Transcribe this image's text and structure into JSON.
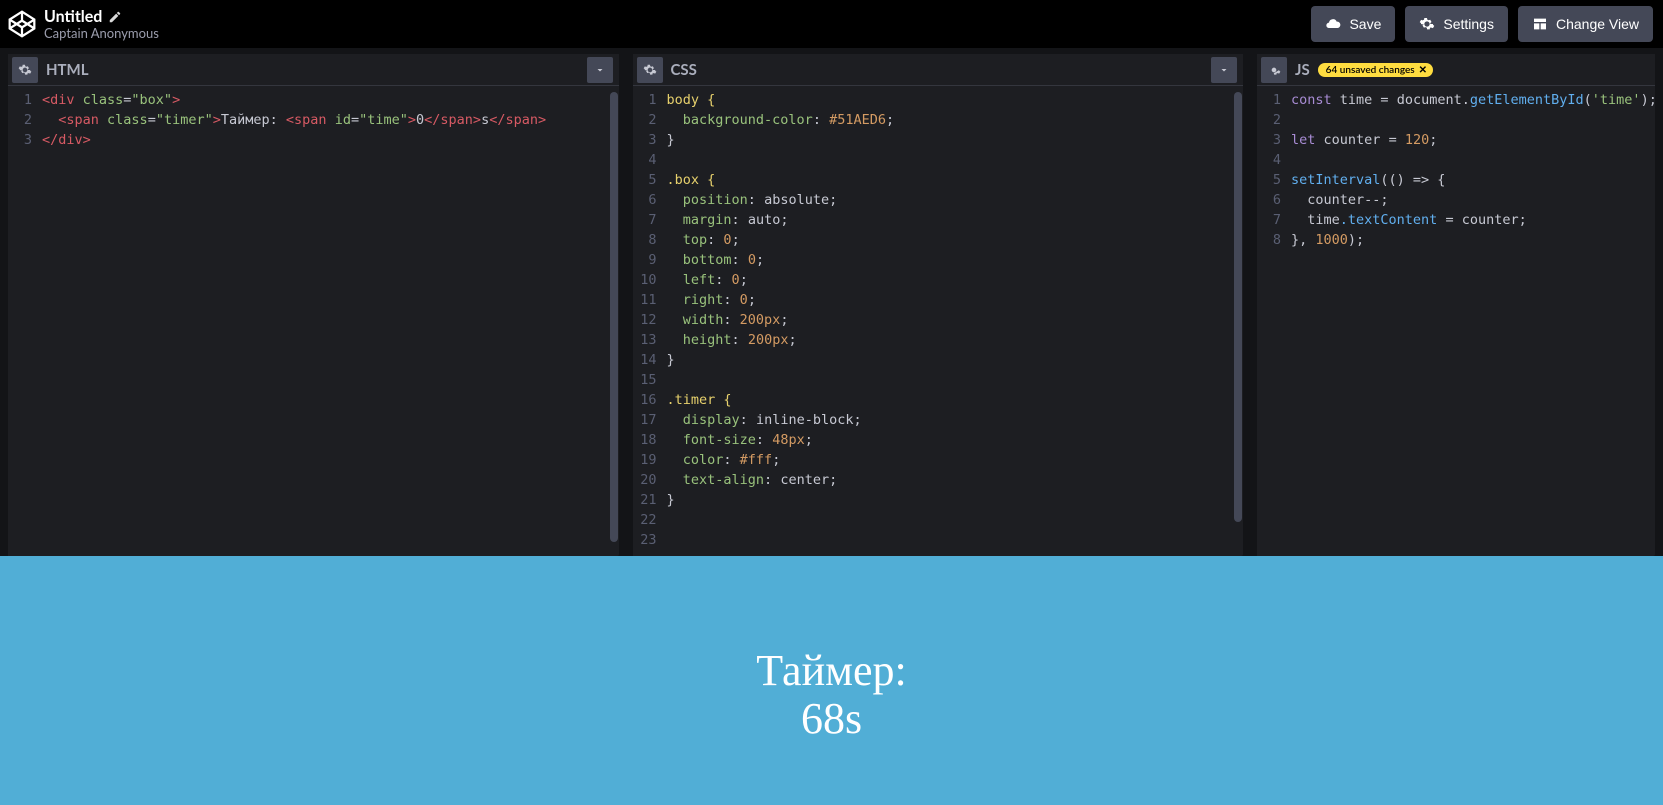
{
  "header": {
    "title": "Untitled",
    "author": "Captain Anonymous",
    "buttons": {
      "save": "Save",
      "settings": "Settings",
      "change_view": "Change View"
    }
  },
  "panels": {
    "html": {
      "title": "HTML",
      "line_count": 3
    },
    "css": {
      "title": "CSS",
      "line_count": 23
    },
    "js": {
      "title": "JS",
      "line_count": 8,
      "badge_text": "64 unsaved changes",
      "badge_close": "✕"
    }
  },
  "code": {
    "html": {
      "l1_open": "<div ",
      "l1_attr": "class",
      "l1_eq": "=",
      "l1_val": "\"box\"",
      "l1_close": ">",
      "l2_indent": "  ",
      "l2_open": "<span ",
      "l2_attr": "class",
      "l2_val": "\"timer\"",
      "l2_close": ">",
      "l2_txt1": "Таймер: ",
      "l2_open2": "<span ",
      "l2_attr2": "id",
      "l2_val2": "\"time\"",
      "l2_close2": ">",
      "l2_txt2": "0",
      "l2_end2": "</span>",
      "l2_txt3": "s",
      "l2_end": "</span>",
      "l3": "</div>"
    },
    "css": {
      "l1": "body {",
      "l2p": "background-color",
      "l2v": "#51AED6",
      "l3": "}",
      "l5": ".box {",
      "l6p": "position",
      "l6v": "absolute",
      "l7p": "margin",
      "l7v": "auto",
      "l8p": "top",
      "l8v": "0",
      "l9p": "bottom",
      "l9v": "0",
      "l10p": "left",
      "l10v": "0",
      "l11p": "right",
      "l11v": "0",
      "l12p": "width",
      "l12v": "200px",
      "l13p": "height",
      "l13v": "200px",
      "l14": "}",
      "l16": ".timer {",
      "l17p": "display",
      "l17v": "inline-block",
      "l18p": "font-size",
      "l18v": "48px",
      "l19p": "color",
      "l19v": "#fff",
      "l20p": "text-align",
      "l20v": "center",
      "l21": "}"
    },
    "js": {
      "l1_kw": "const",
      "l1_id": "time",
      "l1_eq": " = ",
      "l1_obj": "document",
      "l1_dot": ".",
      "l1_fn": "getElementById",
      "l1_arg": "'time'",
      "l1_end": ";",
      "l3_kw": "let",
      "l3_id": "counter",
      "l3_eq": " = ",
      "l3_val": "120",
      "l3_end": ";",
      "l5_fn": "setInterval",
      "l5_rest": "(() => {",
      "l6": "  counter--;",
      "l7a": "  time",
      "l7b": ".textContent",
      "l7c": " = counter;",
      "l8a": "}, ",
      "l8b": "1000",
      "l8c": ");"
    }
  },
  "preview": {
    "line1": "Таймер:",
    "line2": "68s"
  }
}
